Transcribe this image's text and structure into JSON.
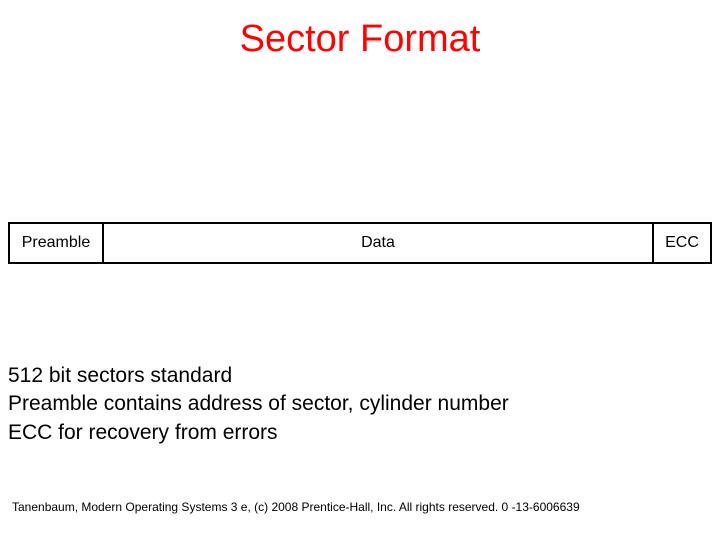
{
  "title": "Sector Format",
  "diagram": {
    "preamble": "Preamble",
    "data": "Data",
    "ecc": "ECC"
  },
  "bullets": {
    "line1": "512 bit sectors standard",
    "line2": "Preamble contains address of sector, cylinder number",
    "line3": "ECC for recovery from errors"
  },
  "footer": "Tanenbaum, Modern Operating Systems 3 e, (c) 2008 Prentice-Hall, Inc. All rights reserved. 0 -13-6006639"
}
